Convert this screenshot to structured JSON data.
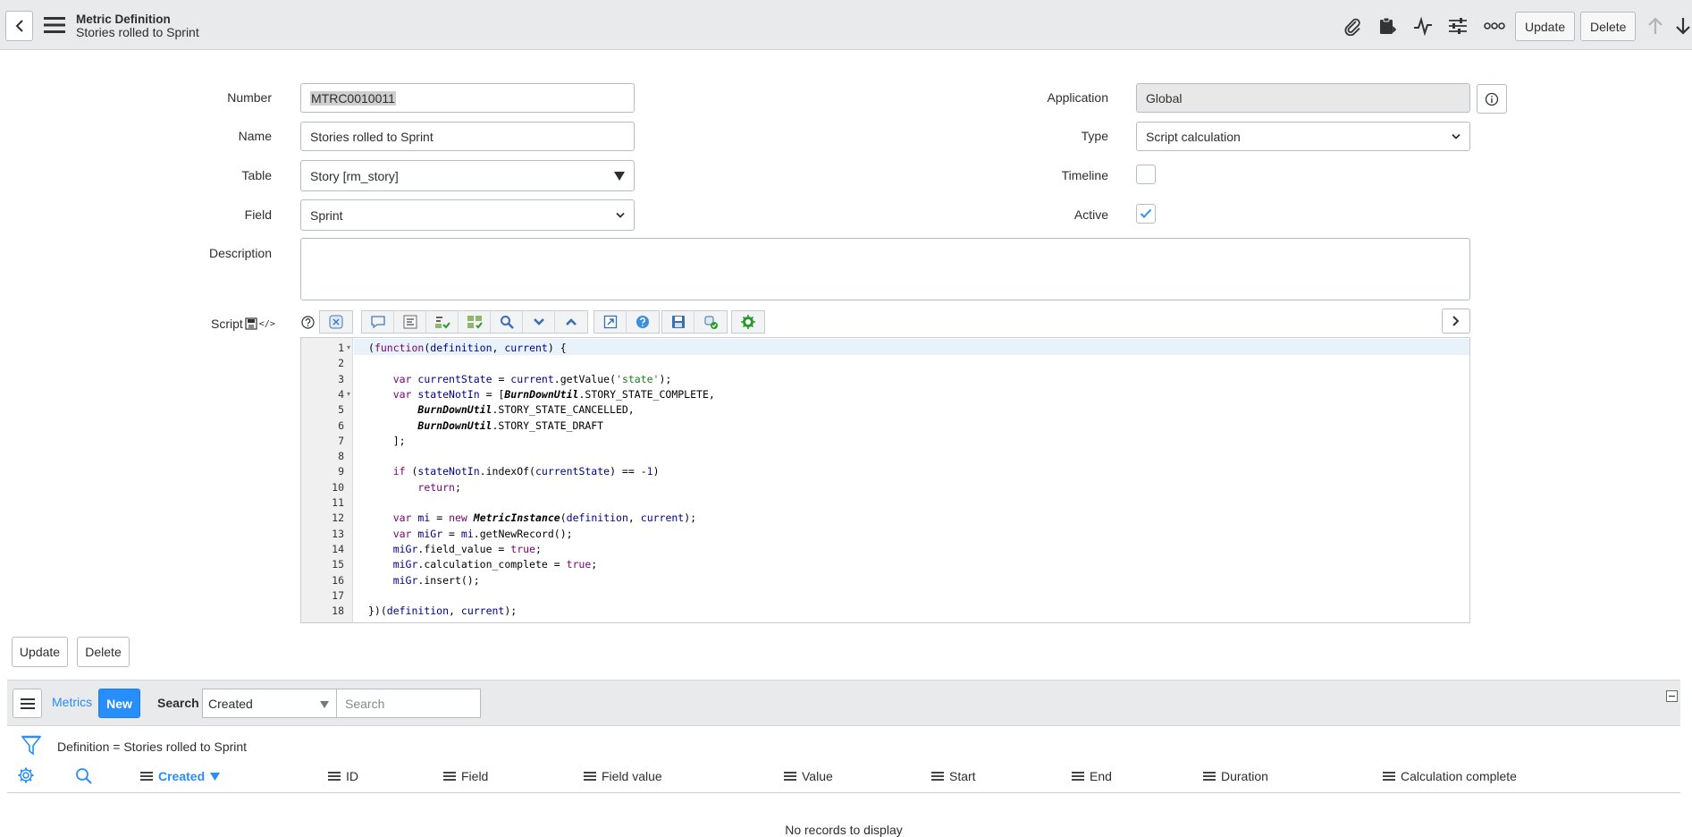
{
  "header": {
    "title": "Metric Definition",
    "subtitle": "Stories rolled to Sprint",
    "update_label": "Update",
    "delete_label": "Delete"
  },
  "form": {
    "number_label": "Number",
    "number_value": "MTRC0010011",
    "name_label": "Name",
    "name_value": "Stories rolled to Sprint",
    "table_label": "Table",
    "table_value": "Story [rm_story]",
    "field_label": "Field",
    "field_value": "Sprint",
    "description_label": "Description",
    "description_value": "",
    "script_label": "Script",
    "application_label": "Application",
    "application_value": "Global",
    "type_label": "Type",
    "type_value": "Script calculation",
    "timeline_label": "Timeline",
    "timeline_checked": false,
    "active_label": "Active",
    "active_checked": true
  },
  "script_lines": [
    "(function(definition, current) {",
    "",
    "    var currentState = current.getValue('state');",
    "    var stateNotIn = [BurnDownUtil.STORY_STATE_COMPLETE,",
    "        BurnDownUtil.STORY_STATE_CANCELLED,",
    "        BurnDownUtil.STORY_STATE_DRAFT",
    "    ];",
    "",
    "    if (stateNotIn.indexOf(currentState) == -1)",
    "        return;",
    "",
    "    var mi = new MetricInstance(definition, current);",
    "    var miGr = mi.getNewRecord();",
    "    miGr.field_value = true;",
    "    miGr.calculation_complete = true;",
    "    miGr.insert();",
    "",
    "})(definition, current);"
  ],
  "actions": {
    "update_label": "Update",
    "delete_label": "Delete"
  },
  "related_list": {
    "tab_label": "Metrics",
    "new_label": "New",
    "search_label": "Search",
    "search_field": "Created",
    "search_placeholder": "Search",
    "filter_text": "Definition = Stories rolled to Sprint",
    "columns": [
      "Created",
      "ID",
      "Field",
      "Field value",
      "Value",
      "Start",
      "End",
      "Duration",
      "Calculation complete"
    ],
    "empty_text": "No records to display"
  },
  "colors": {
    "accent": "#278efc",
    "header_bg": "#e9eaec"
  }
}
